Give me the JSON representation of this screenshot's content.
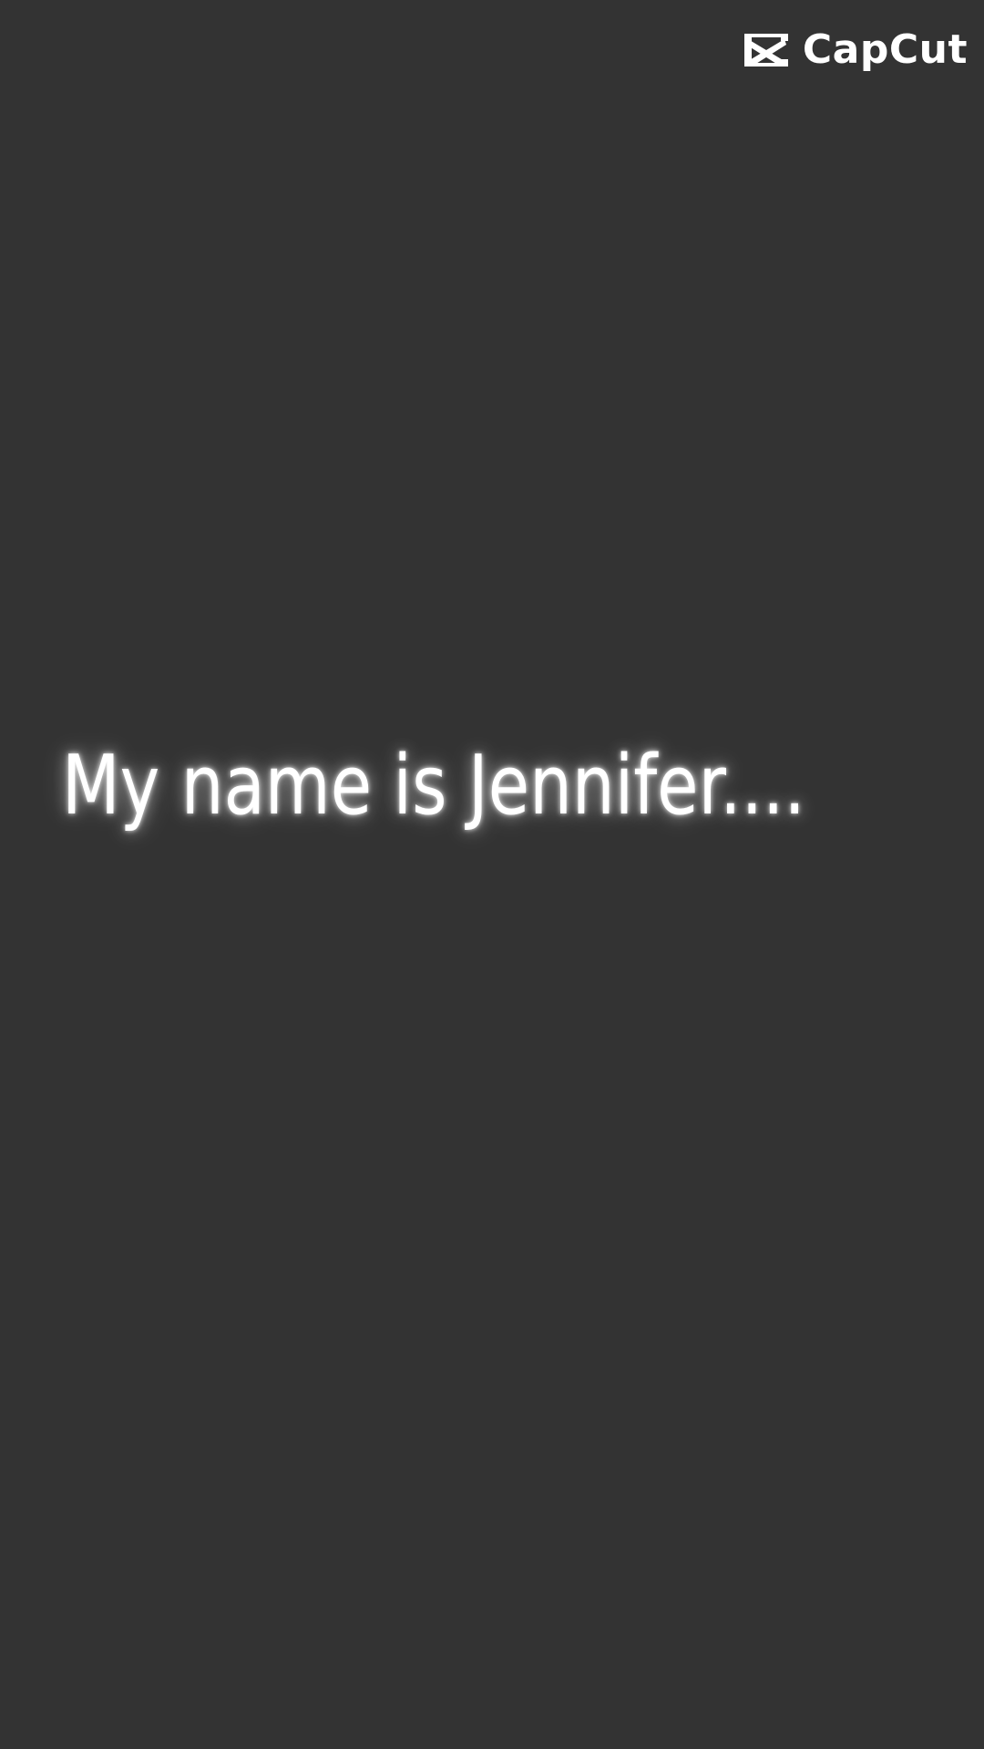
{
  "watermark": {
    "brand": "CapCut",
    "icon": "capcut-logo-icon"
  },
  "caption": {
    "text": "My name is Jennifer...."
  },
  "colors": {
    "background": "#333333",
    "text": "#ffffff",
    "glow": "#ffffff"
  }
}
